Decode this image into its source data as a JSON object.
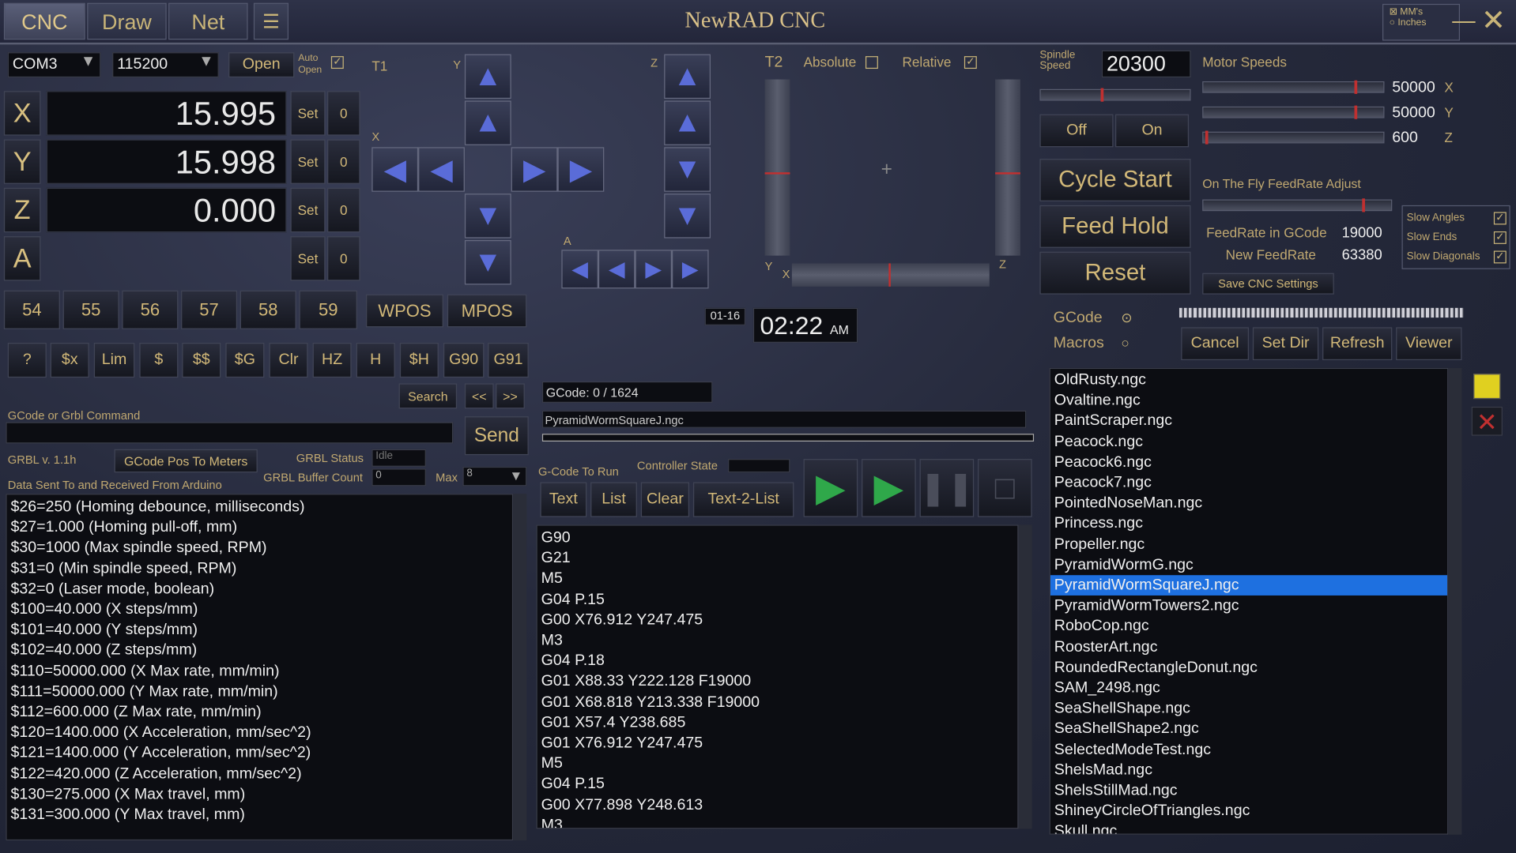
{
  "app": {
    "title": "NewRAD CNC",
    "tabs": [
      "CNC",
      "Draw",
      "Net"
    ]
  },
  "units": {
    "mm": "MM's",
    "inches": "Inches"
  },
  "conn": {
    "port": "COM3",
    "baud": "115200",
    "open": "Open",
    "auto_open": "Auto Open"
  },
  "axes": [
    {
      "name": "X",
      "value": "15.995",
      "set": "Set",
      "zero": "0"
    },
    {
      "name": "Y",
      "value": "15.998",
      "set": "Set",
      "zero": "0"
    },
    {
      "name": "Z",
      "value": "0.000",
      "set": "Set",
      "zero": "0"
    },
    {
      "name": "A",
      "value": "",
      "set": "Set",
      "zero": "0"
    }
  ],
  "wcs": [
    "54",
    "55",
    "56",
    "57",
    "58",
    "59"
  ],
  "pos_mode": {
    "wpos": "WPOS",
    "mpos": "MPOS"
  },
  "cmds": [
    "?",
    "$x",
    "Lim",
    "$",
    "$$",
    "$G",
    "Clr",
    "HZ",
    "H",
    "$H",
    "G90",
    "G91"
  ],
  "search": {
    "label": "Search",
    "prev": "<<",
    "next": ">>"
  },
  "gcode_cmd": {
    "label": "GCode or Grbl Command",
    "send": "Send"
  },
  "grbl": {
    "version": "GRBL v. 1.1h",
    "pos_to_meters": "GCode Pos To Meters",
    "status_label": "GRBL Status",
    "status": "Idle",
    "buffer_label": "GRBL Buffer Count",
    "buffer": "0",
    "max_label": "Max",
    "max": "8",
    "data_label": "Data Sent To and Received From Arduino"
  },
  "jog": {
    "t1": "T1",
    "y": "Y",
    "x": "X",
    "z": "Z",
    "a": "A"
  },
  "t2": {
    "label": "T2",
    "absolute": "Absolute",
    "relative": "Relative",
    "y": "Y",
    "x": "X",
    "z": "Z"
  },
  "spindle": {
    "label": "Spindle Speed",
    "value": "20300",
    "off": "Off",
    "on": "On",
    "level": 0.4
  },
  "motor": {
    "label": "Motor Speeds",
    "rows": [
      {
        "value": "50000",
        "axis": "X"
      },
      {
        "value": "50000",
        "axis": "Y"
      },
      {
        "value": "600",
        "axis": "Z"
      }
    ]
  },
  "controls": {
    "cycle_start": "Cycle Start",
    "feed_hold": "Feed Hold",
    "reset": "Reset"
  },
  "feed": {
    "label": "On The Fly FeedRate Adjust",
    "gcode_label": "FeedRate in GCode",
    "gcode_value": "19000",
    "new_label": "New FeedRate",
    "new_value": "63380",
    "save": "Save CNC Settings"
  },
  "slow": [
    "Slow Angles",
    "Slow Ends",
    "Slow Diagonals"
  ],
  "clock": {
    "date": "01-16",
    "time": "02:22",
    "ampm": "AM"
  },
  "gcode_info": {
    "count": "GCode: 0 / 1624",
    "file": "PyramidWormSquareJ.ngc",
    "to_run": "G-Code To Run",
    "ctrl_state": "Controller State"
  },
  "gtabs": [
    "Text",
    "List",
    "Clear",
    "Text-2-List"
  ],
  "gcode_radio": {
    "gcode": "GCode",
    "macros": "Macros"
  },
  "file_btns": [
    "Cancel",
    "Set Dir",
    "Refresh",
    "Viewer"
  ],
  "log": [
    "$26=250 (Homing debounce, milliseconds)",
    "$27=1.000 (Homing pull-off, mm)",
    "$30=1000 (Max spindle speed, RPM)",
    "$31=0 (Min spindle speed, RPM)",
    "$32=0 (Laser mode, boolean)",
    "$100=40.000 (X steps/mm)",
    "$101=40.000 (Y steps/mm)",
    "$102=40.000 (Z steps/mm)",
    "$110=50000.000 (X Max rate, mm/min)",
    "$111=50000.000 (Y Max rate, mm/min)",
    "$112=600.000 (Z Max rate, mm/min)",
    "$120=1400.000 (X Acceleration, mm/sec^2)",
    "$121=1400.000 (Y Acceleration, mm/sec^2)",
    "$122=420.000 (Z Acceleration, mm/sec^2)",
    "$130=275.000 (X Max travel, mm)",
    "$131=300.000 (Y Max travel, mm)"
  ],
  "gcode_lines": [
    "G90",
    "G21",
    "M5",
    "G04 P.15",
    "G00 X76.912 Y247.475",
    "M3",
    "G04 P.18",
    "G01 X88.33 Y222.128 F19000",
    "G01 X68.818 Y213.338 F19000",
    "G01 X57.4 Y238.685",
    "G01 X76.912 Y247.475",
    "M5",
    "G04 P.15",
    "G00 X77.898 Y248.613",
    "M3"
  ],
  "files": [
    "OldRusty.ngc",
    "Ovaltine.ngc",
    "PaintScraper.ngc",
    "Peacock.ngc",
    "Peacock6.ngc",
    "Peacock7.ngc",
    "PointedNoseMan.ngc",
    "Princess.ngc",
    "Propeller.ngc",
    "PyramidWormG.ngc",
    "PyramidWormSquareJ.ngc",
    "PyramidWormTowers2.ngc",
    "RoboCop.ngc",
    "RoosterArt.ngc",
    "RoundedRectangleDonut.ngc",
    "SAM_2498.ngc",
    "SeaShellShape.ngc",
    "SeaShellShape2.ngc",
    "SelectedModeTest.ngc",
    "ShelsMad.ngc",
    "ShelsStillMad.ngc",
    "ShineyCircleOfTriangles.ngc",
    "Skull.ngc"
  ],
  "selected_file": "PyramidWormSquareJ.ngc"
}
